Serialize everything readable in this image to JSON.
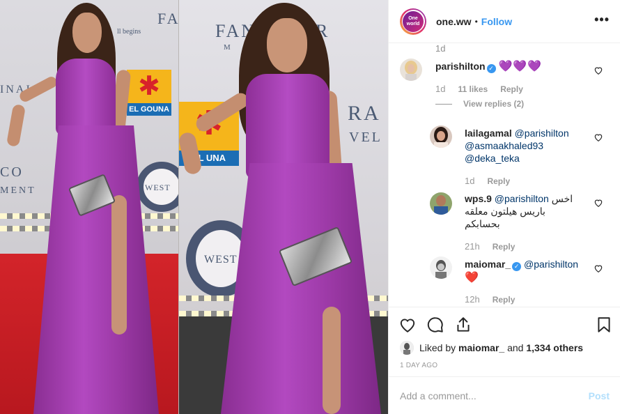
{
  "post": {
    "owner": "one.ww",
    "owner_avatar_text": "One world",
    "separator": "•",
    "follow_label": "Follow",
    "more_label": "•••"
  },
  "photo": {
    "sponsor_left": [
      "FA",
      "INAI",
      "CO",
      "MENT",
      "WEST"
    ],
    "sponsor_right": [
      "FAN",
      "R",
      "M",
      "RA",
      "VEL",
      "WEST"
    ],
    "tagline": "ll begins",
    "logo_text": "EL GOUNA",
    "logo_text_right": "EL  UNA"
  },
  "comments": {
    "top_time": "1d",
    "items": [
      {
        "username": "parishilton",
        "verified": true,
        "text": "💜💜💜",
        "time": "1d",
        "likes": "11 likes",
        "reply_label": "Reply"
      },
      {
        "username": "lailagamal",
        "verified": false,
        "mentions": [
          "@parishilton",
          "@asmaakhaled93",
          "@deka_teka"
        ],
        "time": "1d",
        "reply_label": "Reply"
      },
      {
        "username": "wps.9",
        "verified": false,
        "mention": "@parishilton",
        "text_line1": "اخس",
        "text_line2": "باريس هيلتون معلقه",
        "text_line3": "بحسابكم",
        "time": "21h",
        "reply_label": "Reply"
      },
      {
        "username": "maiomar_",
        "verified": true,
        "mention": "@parishilton",
        "text": "❤️",
        "time": "12h",
        "reply_label": "Reply"
      }
    ],
    "view_replies": "View replies (2)"
  },
  "actions": {
    "liked_by_prefix": "Liked by",
    "liked_by_user": "maiomar_",
    "liked_by_and": "and",
    "liked_by_count": "1,334 others",
    "post_time": "1 DAY AGO"
  },
  "composer": {
    "placeholder": "Add a comment...",
    "post_label": "Post"
  },
  "colors": {
    "link": "#3897f0",
    "mention": "#003569",
    "muted": "#999999",
    "verified": "#3897f0",
    "dress": "#b249c0"
  }
}
